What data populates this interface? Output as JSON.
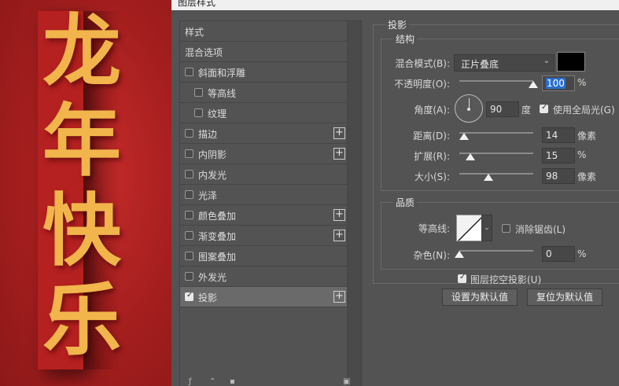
{
  "poster": {
    "chars": [
      "龙",
      "年",
      "快",
      "乐"
    ]
  },
  "dialog": {
    "title": "图层样式"
  },
  "styles_list": {
    "items": [
      {
        "label": "样式",
        "has_checkbox": false,
        "checked": false,
        "has_add": false,
        "indent": false
      },
      {
        "label": "混合选项",
        "has_checkbox": false,
        "checked": false,
        "has_add": false,
        "indent": false
      },
      {
        "label": "斜面和浮雕",
        "has_checkbox": true,
        "checked": false,
        "has_add": false,
        "indent": false
      },
      {
        "label": "等高线",
        "has_checkbox": true,
        "checked": false,
        "has_add": false,
        "indent": true
      },
      {
        "label": "纹理",
        "has_checkbox": true,
        "checked": false,
        "has_add": false,
        "indent": true
      },
      {
        "label": "描边",
        "has_checkbox": true,
        "checked": false,
        "has_add": true,
        "indent": false
      },
      {
        "label": "内阴影",
        "has_checkbox": true,
        "checked": false,
        "has_add": true,
        "indent": false
      },
      {
        "label": "内发光",
        "has_checkbox": true,
        "checked": false,
        "has_add": false,
        "indent": false
      },
      {
        "label": "光泽",
        "has_checkbox": true,
        "checked": false,
        "has_add": false,
        "indent": false
      },
      {
        "label": "颜色叠加",
        "has_checkbox": true,
        "checked": false,
        "has_add": true,
        "indent": false
      },
      {
        "label": "渐变叠加",
        "has_checkbox": true,
        "checked": false,
        "has_add": true,
        "indent": false
      },
      {
        "label": "图案叠加",
        "has_checkbox": true,
        "checked": false,
        "has_add": false,
        "indent": false
      },
      {
        "label": "外发光",
        "has_checkbox": true,
        "checked": false,
        "has_add": false,
        "indent": false
      },
      {
        "label": "投影",
        "has_checkbox": true,
        "checked": true,
        "has_add": true,
        "indent": false,
        "selected": true
      }
    ],
    "footer_icons": [
      "fx-icon",
      "up-arrow-icon",
      "down-arrow-icon",
      "trash-icon"
    ]
  },
  "drop_shadow": {
    "section_title": "投影",
    "structure": {
      "title": "结构",
      "blend_mode_label": "混合模式(B):",
      "blend_mode_value": "正片叠底",
      "shadow_color": "#000000",
      "opacity_label": "不透明度(O):",
      "opacity_value": "100",
      "opacity_unit": "%",
      "opacity_slider": 1.0,
      "angle_label": "角度(A):",
      "angle_value": "90",
      "angle_unit": "度",
      "global_light_label": "使用全局光(G)",
      "global_light_checked": true,
      "distance_label": "距离(D):",
      "distance_value": "14",
      "distance_unit": "像素",
      "distance_slider": 0.06,
      "spread_label": "扩展(R):",
      "spread_value": "15",
      "spread_unit": "%",
      "spread_slider": 0.15,
      "size_label": "大小(S):",
      "size_value": "98",
      "size_unit": "像素",
      "size_slider": 0.39
    },
    "quality": {
      "title": "品质",
      "contour_label": "等高线:",
      "antialias_label": "消除锯齿(L)",
      "antialias_checked": false,
      "noise_label": "杂色(N):",
      "noise_value": "0",
      "noise_unit": "%",
      "noise_slider": 0.0
    },
    "knockout_label": "图层挖空投影(U)",
    "knockout_checked": true,
    "set_default_label": "设置为默认值",
    "reset_default_label": "复位为默认值"
  }
}
